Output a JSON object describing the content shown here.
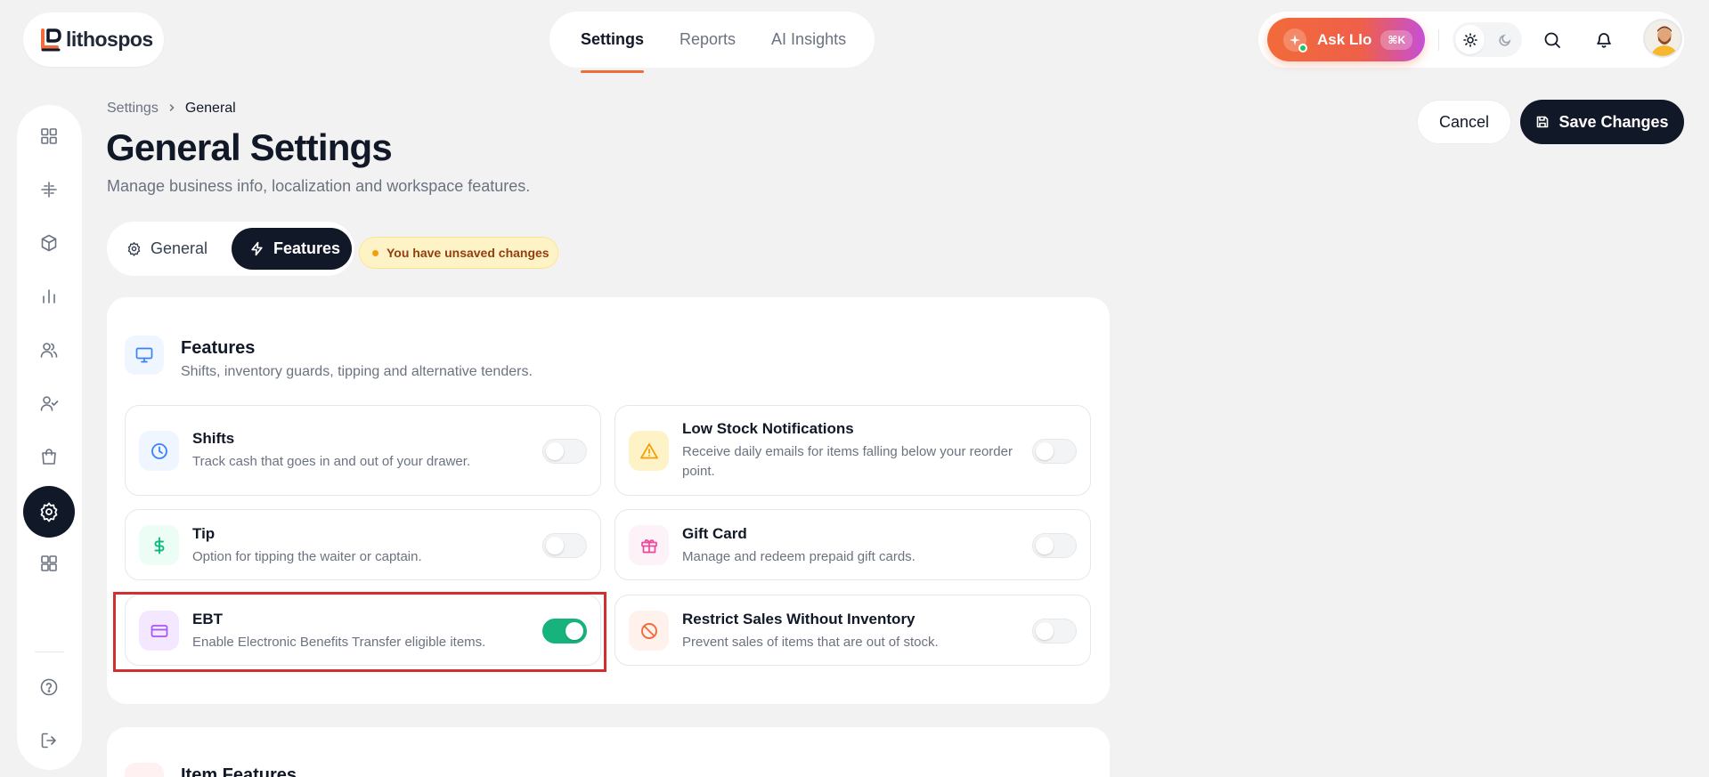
{
  "brand": {
    "name": "lithospos"
  },
  "nav": {
    "items": [
      {
        "label": "Settings",
        "active": true
      },
      {
        "label": "Reports",
        "active": false
      },
      {
        "label": "AI Insights",
        "active": false
      }
    ]
  },
  "ask": {
    "label": "Ask Llo",
    "shortcut": "⌘K"
  },
  "breadcrumb": {
    "root": "Settings",
    "separator": "›",
    "current": "General"
  },
  "page": {
    "title": "General Settings",
    "subtitle": "Manage business info, localization and workspace features."
  },
  "actions": {
    "cancel": "Cancel",
    "save": "Save Changes"
  },
  "tabs": {
    "general": "General",
    "features": "Features",
    "active": "Features"
  },
  "unsaved": "You have unsaved changes",
  "features_section": {
    "title": "Features",
    "subtitle": "Shifts, inventory guards, tipping and alternative tenders.",
    "items": [
      {
        "title": "Shifts",
        "description": "Track cash that goes in and out of your drawer.",
        "enabled": false,
        "icon": "clock-icon",
        "color": "#3b82f6"
      },
      {
        "title": "Low Stock Notifications",
        "description": "Receive daily emails for items falling below your reorder point.",
        "enabled": false,
        "icon": "warning-icon",
        "color": "#f59e0b"
      },
      {
        "title": "Tip",
        "description": "Option for tipping the waiter or captain.",
        "enabled": false,
        "icon": "dollar-icon",
        "color": "#10b981"
      },
      {
        "title": "Gift Card",
        "description": "Manage and redeem prepaid gift cards.",
        "enabled": false,
        "icon": "gift-icon",
        "color": "#ec4899"
      },
      {
        "title": "EBT",
        "description": "Enable Electronic Benefits Transfer eligible items.",
        "enabled": true,
        "icon": "credit-card-icon",
        "color": "#a855f7"
      },
      {
        "title": "Restrict Sales Without Inventory",
        "description": "Prevent sales of items that are out of stock.",
        "enabled": false,
        "icon": "ban-icon",
        "color": "#f26b3a"
      }
    ]
  },
  "item_features_section": {
    "title": "Item Features"
  },
  "sidebar": {
    "items": [
      {
        "name": "dashboard",
        "icon": "grid-icon",
        "active": false
      },
      {
        "name": "pos",
        "icon": "hash-icon",
        "active": false
      },
      {
        "name": "inventory",
        "icon": "box-icon",
        "active": false
      },
      {
        "name": "analytics",
        "icon": "bar-chart-icon",
        "active": false
      },
      {
        "name": "customers",
        "icon": "users-icon",
        "active": false
      },
      {
        "name": "staff",
        "icon": "user-check-icon",
        "active": false
      },
      {
        "name": "orders",
        "icon": "shopping-bag-icon",
        "active": false
      },
      {
        "name": "settings",
        "icon": "gear-icon",
        "active": true
      },
      {
        "name": "apps",
        "icon": "apps-icon",
        "active": false
      },
      {
        "name": "help",
        "icon": "help-icon",
        "active": false
      },
      {
        "name": "logout",
        "icon": "logout-icon",
        "active": false
      }
    ]
  },
  "colors": {
    "accent": "#f26b3a",
    "dark": "#111827",
    "toggle_on": "#16b37d",
    "highlight": "#d32f2f"
  }
}
